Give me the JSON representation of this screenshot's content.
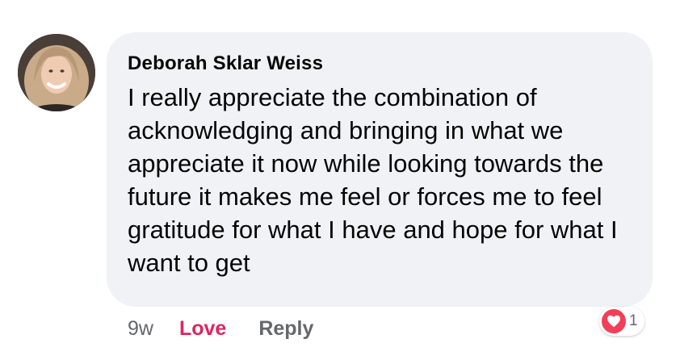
{
  "comment": {
    "author": "Deborah Sklar Weiss",
    "text": "I really appreciate the combination of acknowledging and bringing in what we appreciate it now while looking towards the future it makes me feel or forces me to feel gratitude for what I have and hope for what I want to get"
  },
  "actions": {
    "time": "9w",
    "love_label": "Love",
    "reply_label": "Reply"
  },
  "reactions": {
    "icon": "heart-icon",
    "count": "1",
    "color": "#f33e58"
  },
  "colors": {
    "bubble": "#f0f2f5",
    "love_active": "#e0245e",
    "secondary_text": "#65676b"
  }
}
